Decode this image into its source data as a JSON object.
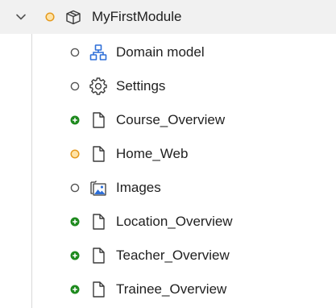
{
  "tree": {
    "module": {
      "label": "MyFirstModule",
      "status": "modified",
      "icon": "module-box-icon"
    },
    "items": [
      {
        "label": "Domain model",
        "status": "unchanged",
        "icon": "domain-model-icon"
      },
      {
        "label": "Settings",
        "status": "unchanged",
        "icon": "gear-icon"
      },
      {
        "label": "Course_Overview",
        "status": "added",
        "icon": "page-icon"
      },
      {
        "label": "Home_Web",
        "status": "modified",
        "icon": "page-icon"
      },
      {
        "label": "Images",
        "status": "unchanged",
        "icon": "image-folder-icon"
      },
      {
        "label": "Location_Overview",
        "status": "added",
        "icon": "page-icon"
      },
      {
        "label": "Teacher_Overview",
        "status": "added",
        "icon": "page-icon"
      },
      {
        "label": "Trainee_Overview",
        "status": "added",
        "icon": "page-icon"
      }
    ]
  },
  "colors": {
    "modified": "#f0a830",
    "added": "#1e8a1e",
    "unchanged": "#6b6b6b",
    "domain_icon": "#2e6fd8"
  }
}
